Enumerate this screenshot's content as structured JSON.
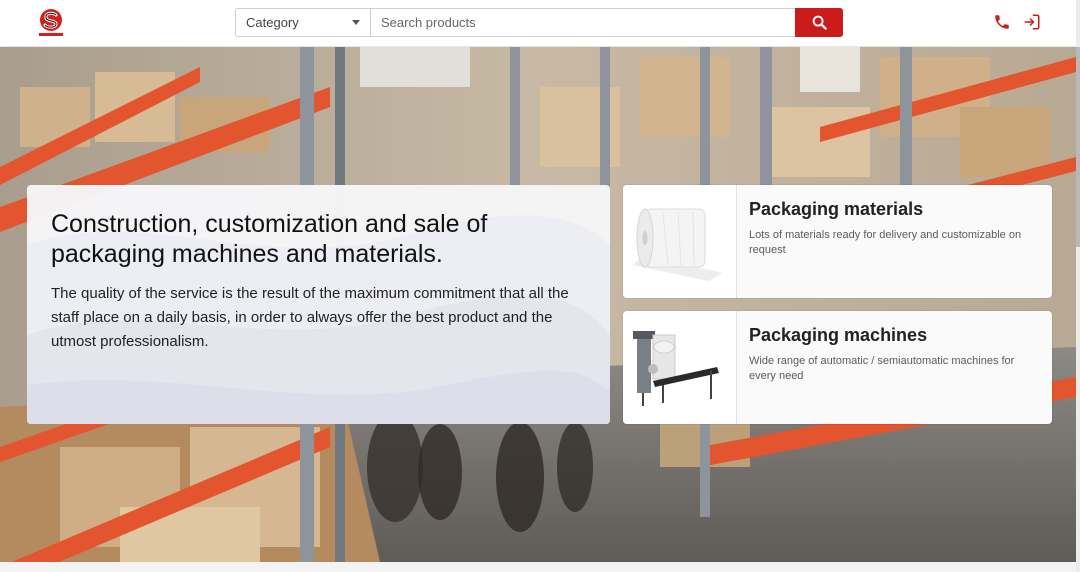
{
  "header": {
    "logo_text": "SIRIM",
    "category_label": "Category",
    "search_placeholder": "Search products",
    "search_button": "search-icon",
    "actions": [
      "phone-icon",
      "login-icon"
    ]
  },
  "colors": {
    "accent": "#cc1b1b",
    "card_bg": "#fafafa"
  },
  "hero": {
    "title": "Construction, customization and sale of packaging machines and materials.",
    "text": "The quality of the service is the result of the maximum commitment that all the staff place on a daily basis, in order to always offer the best product and the utmost professionalism."
  },
  "categories": [
    {
      "title": "Packaging materials",
      "description": "Lots of materials ready for delivery and customizable on request",
      "icon": "foam-roll-image"
    },
    {
      "title": "Packaging machines",
      "description": "Wide range of automatic / semiautomatic machines for every need",
      "icon": "machine-image"
    }
  ]
}
